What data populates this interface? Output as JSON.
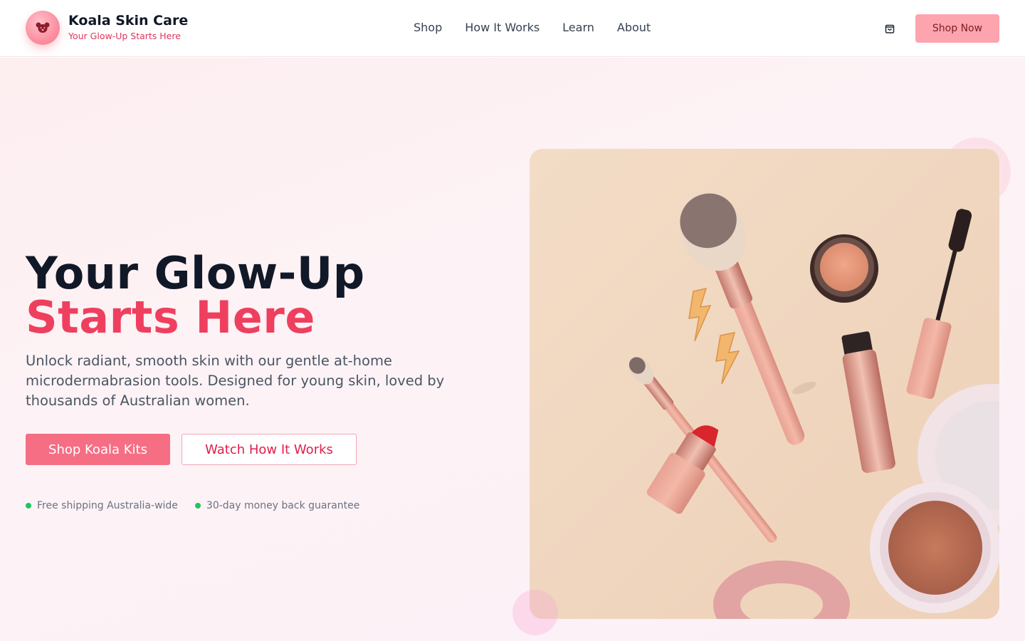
{
  "brand": {
    "name": "Koala Skin Care",
    "tagline": "Your Glow-Up Starts Here",
    "logo_icon": "koala-icon"
  },
  "nav": {
    "items": [
      {
        "label": "Shop"
      },
      {
        "label": "How It Works"
      },
      {
        "label": "Learn"
      },
      {
        "label": "About"
      }
    ]
  },
  "header_actions": {
    "cart_icon": "shopping-bag-icon",
    "shop_now_label": "Shop Now"
  },
  "hero": {
    "headline_line1": "Your Glow-Up",
    "headline_line2": "Starts Here",
    "subtitle": "Unlock radiant, smooth skin with our gentle at-home microdermabrasion tools. Designed for young skin, loved by thousands of Australian women.",
    "primary_cta": "Shop Koala Kits",
    "secondary_cta": "Watch How It Works",
    "badges": [
      {
        "label": "Free shipping Australia-wide"
      },
      {
        "label": "30-day money back guarantee"
      }
    ]
  },
  "colors": {
    "accent": "#ef3f5f",
    "button_primary": "#f56e84",
    "button_header": "#fda4af",
    "badge_dot": "#22c55e",
    "image_bg": "#f0d6bf"
  }
}
